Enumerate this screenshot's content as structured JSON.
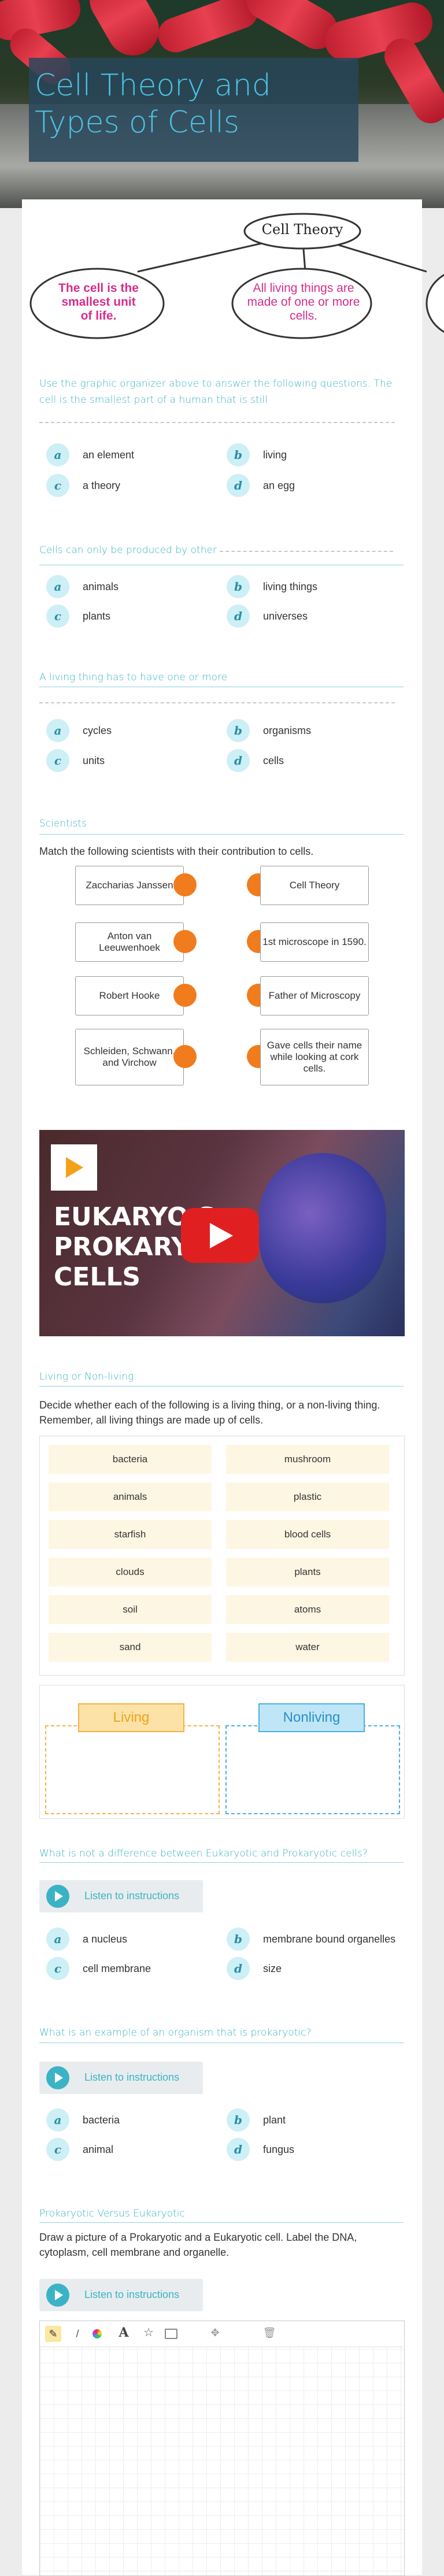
{
  "title": "Cell Theory and Types of Cells",
  "organizer": {
    "center": "Cell Theory",
    "left": "The cell is the smallest unit of life.",
    "middle": "All living things are made of one or more cells."
  },
  "q1": {
    "prompt": "Use the graphic organizer above to answer the following questions. The cell is the smallest part of a human that is still",
    "options": [
      {
        "letter": "a",
        "text": "an element"
      },
      {
        "letter": "b",
        "text": "living"
      },
      {
        "letter": "c",
        "text": "a theory"
      },
      {
        "letter": "d",
        "text": "an egg"
      }
    ]
  },
  "q2": {
    "prompt": "Cells can only be produced by other",
    "options": [
      {
        "letter": "a",
        "text": "animals"
      },
      {
        "letter": "b",
        "text": "living things"
      },
      {
        "letter": "c",
        "text": "plants"
      },
      {
        "letter": "d",
        "text": "universes"
      }
    ]
  },
  "q3": {
    "prompt": "A living thing has to have one or more",
    "options": [
      {
        "letter": "a",
        "text": "cycles"
      },
      {
        "letter": "b",
        "text": "organisms"
      },
      {
        "letter": "c",
        "text": "units"
      },
      {
        "letter": "d",
        "text": "cells"
      }
    ]
  },
  "scientists": {
    "heading": "Scientists",
    "instruction": "Match the following scientists with their contribution to cells.",
    "left": [
      "Zaccharias Janssen",
      "Anton van Leeuwenhoek",
      "Robert Hooke",
      "Schleiden, Schwann, and Virchow"
    ],
    "right": [
      "Cell Theory",
      "1st microscope in 1590.",
      "Father of Microscopy",
      "Gave cells their name while looking at cork cells."
    ]
  },
  "video": {
    "title_line1": "EUKARYO    S.",
    "title_line2": "PROKARYO",
    "title_line3": "CELLS"
  },
  "living": {
    "heading": "Living or Non-living",
    "instruction": "Decide whether each of the following is a living thing, or a non-living thing. Remember, all living things are made up of cells.",
    "items": [
      "bacteria",
      "mushroom",
      "animals",
      "plastic",
      "starfish",
      "blood cells",
      "clouds",
      "plants",
      "soil",
      "atoms",
      "sand",
      "water"
    ],
    "bin_living": "Living",
    "bin_nonliving": "Nonliving"
  },
  "q4": {
    "prompt": "What is not a difference between Eukaryotic and Prokaryotic cells?",
    "listen": "Listen to instructions",
    "options": [
      {
        "letter": "a",
        "text": "a nucleus"
      },
      {
        "letter": "b",
        "text": "membrane bound organelles"
      },
      {
        "letter": "c",
        "text": "cell membrane"
      },
      {
        "letter": "d",
        "text": "size"
      }
    ]
  },
  "q5": {
    "prompt": "What is an example of an organism that is prokaryotic?",
    "listen": "Listen to instructions",
    "options": [
      {
        "letter": "a",
        "text": "bacteria"
      },
      {
        "letter": "b",
        "text": "plant"
      },
      {
        "letter": "c",
        "text": "animal"
      },
      {
        "letter": "d",
        "text": "fungus"
      }
    ]
  },
  "drawing": {
    "heading": "Prokaryotic Versus Eukaryotic",
    "instruction": "Draw a picture of a Prokaryotic and a Eukaryotic cell. Label the DNA, cytoplasm, cell membrane and organelle.",
    "listen": "Listen to instructions"
  }
}
